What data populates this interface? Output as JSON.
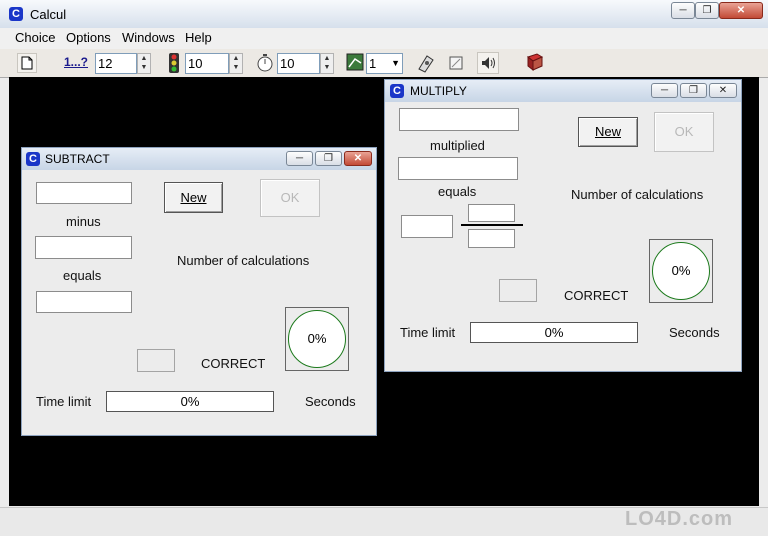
{
  "window": {
    "title": "Calcul",
    "min_glyph": "─",
    "max_glyph": "❐",
    "close_glyph": "✕",
    "icon": "app-c-icon"
  },
  "menu": {
    "items": [
      {
        "label": "Choice"
      },
      {
        "label": "Options"
      },
      {
        "label": "Windows"
      },
      {
        "label": "Help"
      }
    ]
  },
  "toolbar": {
    "new_icon": "document-icon",
    "count_label": "1...?",
    "count_value": "12",
    "traffic_value": "10",
    "timer_value": "10",
    "level_value": "1",
    "level_arrow": "▼",
    "spin_up": "▲",
    "spin_down": "▼",
    "icons": [
      "document-icon",
      "traffic-light-icon",
      "stopwatch-icon",
      "level-icon",
      "calculator-icon",
      "eraser-icon",
      "speaker-icon",
      "book-icon"
    ]
  },
  "subtract_window": {
    "title": "SUBTRACT",
    "word_op": "minus",
    "word_eq": "equals",
    "new_label": "New",
    "ok_label": "OK",
    "num_calc_label": "Number of calculations",
    "correct_label": "CORRECT",
    "percent": "0%",
    "time_limit_label": "Time limit",
    "progress_text": "0%",
    "seconds_label": "Seconds"
  },
  "multiply_window": {
    "title": "MULTIPLY",
    "word_op": "multiplied",
    "word_eq": "equals",
    "new_label": "New",
    "ok_label": "OK",
    "num_calc_label": "Number of calculations",
    "correct_label": "CORRECT",
    "percent": "0%",
    "time_limit_label": "Time limit",
    "progress_text": "0%",
    "seconds_label": "Seconds"
  },
  "watermark": {
    "text": "LO4D.com"
  },
  "colors": {
    "workspace": "#000000",
    "app_icon": "#1a36c8",
    "close_button": "#c24a36"
  }
}
